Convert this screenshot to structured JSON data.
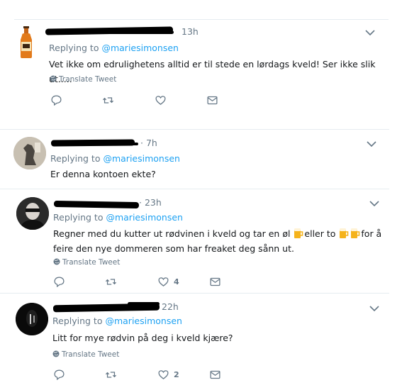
{
  "tweets": [
    {
      "time": "13h",
      "replying_prefix": "Replying to",
      "replying_handle": "@mariesimonsen",
      "text": "Vet ikke om edrulighetens alltid er til stede en lørdags kveld! Ser ikke slik ut.....",
      "translate": "Translate Tweet",
      "like_count": ""
    },
    {
      "time": "7h",
      "replying_prefix": "Replying to",
      "replying_handle": "@mariesimonsen",
      "text": "Er denna kontoen ekte?",
      "translate": "",
      "like_count": ""
    },
    {
      "time": "23h",
      "replying_prefix": "Replying to",
      "replying_handle": "@mariesimonsen",
      "text_part1": "Regner med du kutter ut rødvinen i kveld og tar en øl ",
      "text_part2": "eller to ",
      "text_part3": "for  å",
      "text_line2": "feire den nye dommeren som har freaket deg sånn ut.",
      "translate": "Translate Tweet",
      "like_count": "4"
    },
    {
      "time": "22h",
      "replying_prefix": "Replying to",
      "replying_handle": "@mariesimonsen",
      "text": "Litt for mye rødvin på deg i kveld kjære?",
      "translate": "Translate Tweet",
      "like_count": "2"
    }
  ],
  "icons": {
    "reply": "reply-icon",
    "retweet": "retweet-icon",
    "like": "heart-icon",
    "dm": "envelope-icon",
    "more": "chevron-down-icon",
    "translate": "globe-icon",
    "beer": "beer-mug-icon"
  },
  "colors": {
    "link": "#1da1f2",
    "meta": "#657786",
    "text": "#14171a",
    "divider": "#e6ecf0"
  }
}
